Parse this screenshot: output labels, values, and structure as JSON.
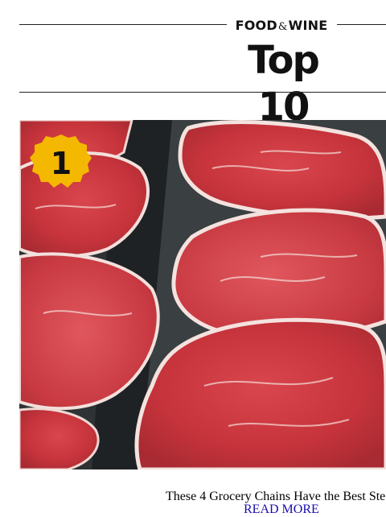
{
  "header": {
    "brand_left": "FOOD",
    "brand_amp": "&",
    "brand_right": "WINE",
    "title": "Top 10"
  },
  "hero": {
    "rank_badge": "1",
    "badge_color": "#f5b800",
    "image_icon": "raw-steak-photo"
  },
  "article": {
    "caption": "These 4 Grocery Chains Have the Best Ste",
    "read_more": "READ MORE",
    "link_color": "#1a0dab"
  }
}
